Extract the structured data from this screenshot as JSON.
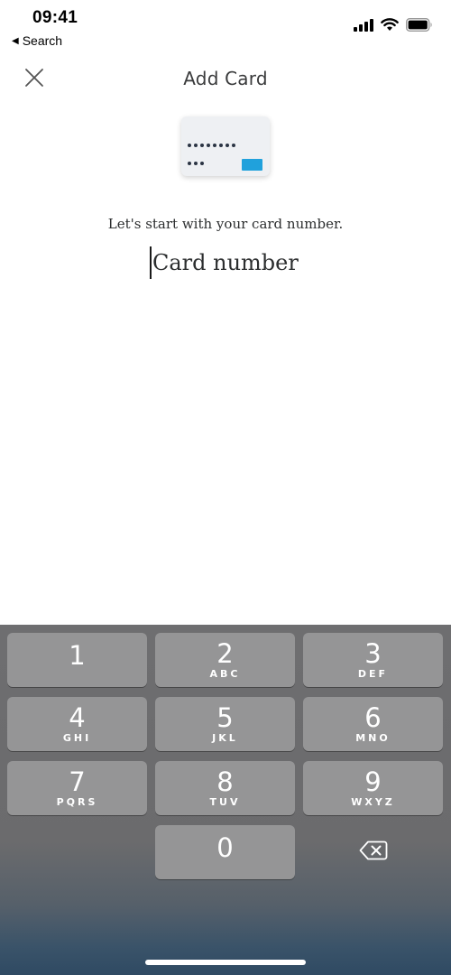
{
  "status_bar": {
    "time": "09:41",
    "back_app_label": "Search",
    "icons": [
      "cellular-signal-icon",
      "wifi-icon",
      "battery-icon"
    ]
  },
  "header": {
    "title": "Add Card",
    "close_icon": "close-icon"
  },
  "card_illustration": {
    "icon": "credit-card-icon",
    "chip_color": "#20a1dc"
  },
  "form": {
    "prompt": "Let's start with your card number.",
    "card_number": {
      "value": "",
      "placeholder": "Card number"
    }
  },
  "keyboard": {
    "keys": [
      {
        "digit": "1",
        "letters": ""
      },
      {
        "digit": "2",
        "letters": "ABC"
      },
      {
        "digit": "3",
        "letters": "DEF"
      },
      {
        "digit": "4",
        "letters": "GHI"
      },
      {
        "digit": "5",
        "letters": "JKL"
      },
      {
        "digit": "6",
        "letters": "MNO"
      },
      {
        "digit": "7",
        "letters": "PQRS"
      },
      {
        "digit": "8",
        "letters": "TUV"
      },
      {
        "digit": "9",
        "letters": "WXYZ"
      },
      {
        "digit": "0",
        "letters": ""
      }
    ],
    "delete_icon": "backspace-icon"
  }
}
